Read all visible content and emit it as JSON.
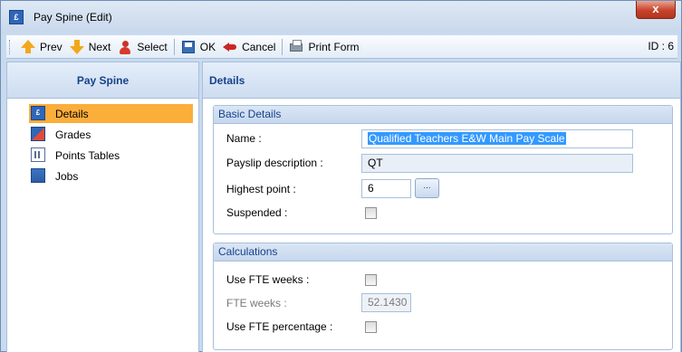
{
  "window": {
    "title": "Pay Spine (Edit)",
    "close_label": "x"
  },
  "toolbar": {
    "prev_label": "Prev",
    "next_label": "Next",
    "select_label": "Select",
    "ok_label": "OK",
    "cancel_label": "Cancel",
    "print_label": "Print Form",
    "id_label": "ID : 6"
  },
  "sidebar": {
    "header": "Pay Spine",
    "items": [
      {
        "label": "Details",
        "icon": "details-icon",
        "active": true
      },
      {
        "label": "Grades",
        "icon": "grades-icon",
        "active": false
      },
      {
        "label": "Points Tables",
        "icon": "points-tables-icon",
        "active": false
      },
      {
        "label": "Jobs",
        "icon": "jobs-icon",
        "active": false
      }
    ]
  },
  "main": {
    "header": "Details",
    "basic_details": {
      "title": "Basic Details",
      "name_label": "Name :",
      "name_value": "Qualified Teachers E&W Main Pay Scale",
      "payslip_label": "Payslip description :",
      "payslip_value": "QT",
      "highest_point_label": "Highest point :",
      "highest_point_value": "6",
      "ellipsis_label": "...",
      "suspended_label": "Suspended :",
      "suspended_checked": false
    },
    "calculations": {
      "title": "Calculations",
      "use_fte_weeks_label": "Use FTE weeks :",
      "use_fte_weeks_checked": false,
      "fte_weeks_label": "FTE weeks :",
      "fte_weeks_value": "52.1430",
      "use_fte_percentage_label": "Use FTE percentage :",
      "use_fte_percentage_checked": false
    }
  },
  "colors": {
    "active_item": "#fbae3a",
    "header_text": "#15428b",
    "selection": "#3399ff"
  }
}
